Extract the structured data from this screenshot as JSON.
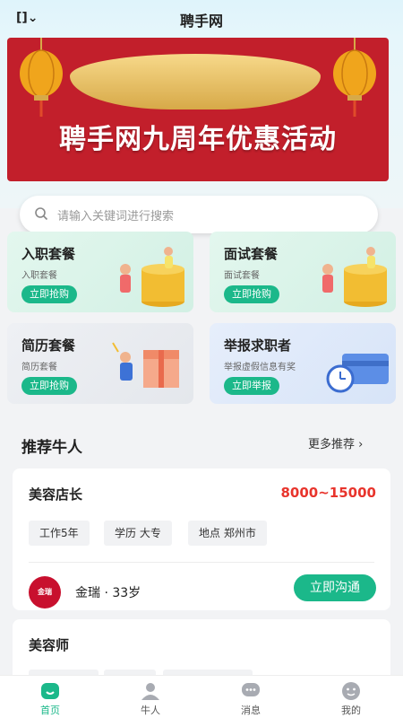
{
  "header": {
    "menu_glyph": "[]",
    "title": "聘手网"
  },
  "banner": {
    "text": "聘手网九周年优惠活动"
  },
  "search": {
    "placeholder": "请输入关键词进行搜索"
  },
  "cards": [
    {
      "title": "入职套餐",
      "subtitle": "入职套餐",
      "button": "立即抢购"
    },
    {
      "title": "面试套餐",
      "subtitle": "面试套餐",
      "button": "立即抢购"
    },
    {
      "title": "简历套餐",
      "subtitle": "简历套餐",
      "button": "立即抢购"
    },
    {
      "title": "举报求职者",
      "subtitle": "举报虚假信息有奖",
      "button": "立即举报"
    }
  ],
  "section": {
    "title": "推荐牛人",
    "more": "更多推荐"
  },
  "jobs": [
    {
      "title": "美容店长",
      "salary": "8000~15000",
      "tags": [
        "工作5年",
        "学历 大专",
        "地点 郑州市"
      ],
      "person": "金瑞 · 33岁",
      "avatar_text": "金瑞",
      "action": "立即沟通"
    },
    {
      "title": "美容师"
    }
  ],
  "tabs": [
    {
      "label": "首页",
      "icon": "home-icon"
    },
    {
      "label": "牛人",
      "icon": "person-icon"
    },
    {
      "label": "消息",
      "icon": "message-icon"
    },
    {
      "label": "我的",
      "icon": "profile-icon"
    }
  ],
  "colors": {
    "accent": "#1bb88a",
    "salary": "#e8342c",
    "banner": "#c21f2b"
  }
}
